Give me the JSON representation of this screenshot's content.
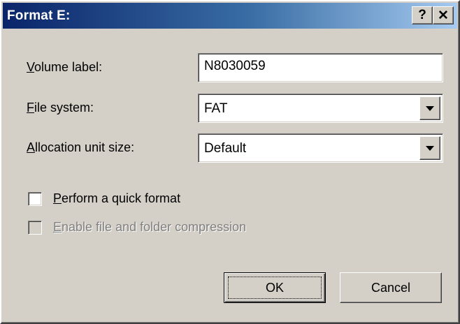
{
  "window": {
    "title": "Format E:",
    "help_glyph": "?",
    "close_glyph": "✕"
  },
  "fields": {
    "volume_label": {
      "label_u": "V",
      "label_rest": "olume label:",
      "value": "N8030059"
    },
    "file_system": {
      "label_u": "F",
      "label_rest": "ile system:",
      "value": "FAT"
    },
    "allocation_unit_size": {
      "label_u": "A",
      "label_rest": "llocation unit size:",
      "value": "Default"
    }
  },
  "options": {
    "quick_format": {
      "label_u": "P",
      "label_rest": "erform a quick format",
      "checked": false,
      "enabled": true
    },
    "compression": {
      "label_u": "E",
      "label_rest": "nable file and folder compression",
      "checked": false,
      "enabled": false
    }
  },
  "buttons": {
    "ok": "OK",
    "cancel": "Cancel"
  },
  "colors": {
    "titlebar_start": "#0a246a",
    "titlebar_end": "#a6caf0",
    "face": "#d4d0c8"
  }
}
